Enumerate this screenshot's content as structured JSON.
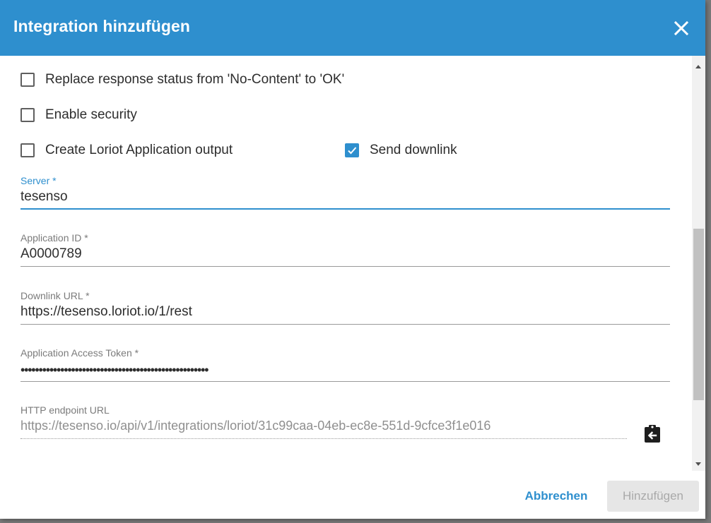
{
  "dialog": {
    "title": "Integration hinzufügen",
    "close_icon": "close-icon"
  },
  "options": {
    "replace_status": {
      "label": "Replace response status from 'No-Content' to 'OK'",
      "checked": false
    },
    "enable_security": {
      "label": "Enable security",
      "checked": false
    },
    "create_output": {
      "label": "Create Loriot Application output",
      "checked": false
    },
    "send_downlink": {
      "label": "Send downlink",
      "checked": true
    }
  },
  "fields": {
    "server": {
      "label": "Server *",
      "value": "tesenso"
    },
    "application_id": {
      "label": "Application ID *",
      "value": "A0000789"
    },
    "downlink_url": {
      "label": "Downlink URL *",
      "value": "https://tesenso.loriot.io/1/rest"
    },
    "access_token": {
      "label": "Application Access Token *",
      "value": "••••••••••••••••••••••••••••••••••••••••••••••••••••"
    },
    "http_endpoint": {
      "label": "HTTP endpoint URL",
      "value": "https://tesenso.io/api/v1/integrations/loriot/31c99caa-04eb-ec8e-551d-9cfce3f1e016",
      "copy_icon": "clipboard-copy-icon"
    }
  },
  "footer": {
    "cancel_label": "Abbrechen",
    "add_label": "Hinzufügen"
  },
  "colors": {
    "accent": "#2e8fce",
    "header": "#2e8fce",
    "text": "#2d2d2d",
    "muted": "#7b7b7b"
  }
}
